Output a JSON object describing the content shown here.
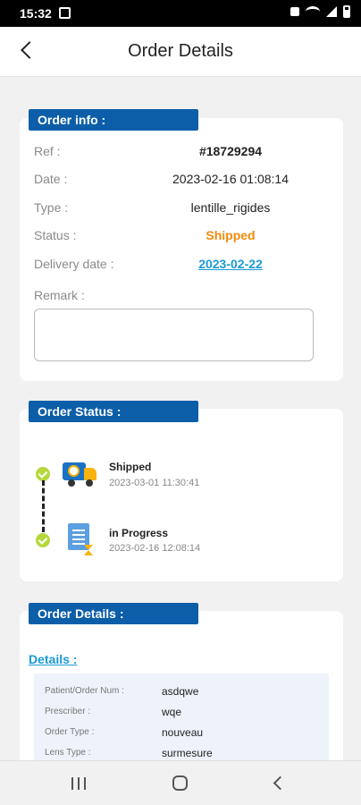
{
  "status_bar": {
    "time": "15:32",
    "icons": [
      "image-icon",
      "notification-icon",
      "wifi-icon",
      "signal-icon",
      "battery-icon"
    ]
  },
  "header": {
    "title": "Order Details",
    "back_icon": "chevron-left-icon"
  },
  "order_info": {
    "section_title": "Order info :",
    "fields": {
      "ref": {
        "label": "Ref :",
        "value": "#18729294"
      },
      "date": {
        "label": "Date :",
        "value": "2023-02-16 01:08:14"
      },
      "type": {
        "label": "Type :",
        "value": "lentille_rigides"
      },
      "status": {
        "label": "Status :",
        "value": "Shipped",
        "color": "#f08a0c"
      },
      "delivery_date": {
        "label": "Delivery date :",
        "value": "2023-02-22",
        "color": "#1a9ad6"
      }
    },
    "remark": {
      "label": "Remark :",
      "value": ""
    }
  },
  "order_status": {
    "section_title": "Order Status :",
    "steps": [
      {
        "title": "Shipped",
        "time": "2023-03-01 11:30:41",
        "icon": "delivery-truck-icon"
      },
      {
        "title": "in Progress",
        "time": "2023-02-16 12:08:14",
        "icon": "document-hourglass-icon"
      }
    ]
  },
  "order_details": {
    "section_title": "Order Details :",
    "details_link": "Details :",
    "rows": [
      {
        "label": "Patient/Order Num :",
        "value": "asdqwe"
      },
      {
        "label": "Prescriber :",
        "value": "wqe"
      },
      {
        "label": "Order Type :",
        "value": "nouveau"
      },
      {
        "label": "Lens Type :",
        "value": "surmesure"
      }
    ]
  },
  "colors": {
    "accent": "#0c5ea9",
    "status_shipped": "#f08a0c",
    "link": "#1a9ad6",
    "check": "#b6d83d"
  },
  "nav": {
    "icons": [
      "recent-apps-icon",
      "home-icon",
      "back-icon"
    ]
  }
}
